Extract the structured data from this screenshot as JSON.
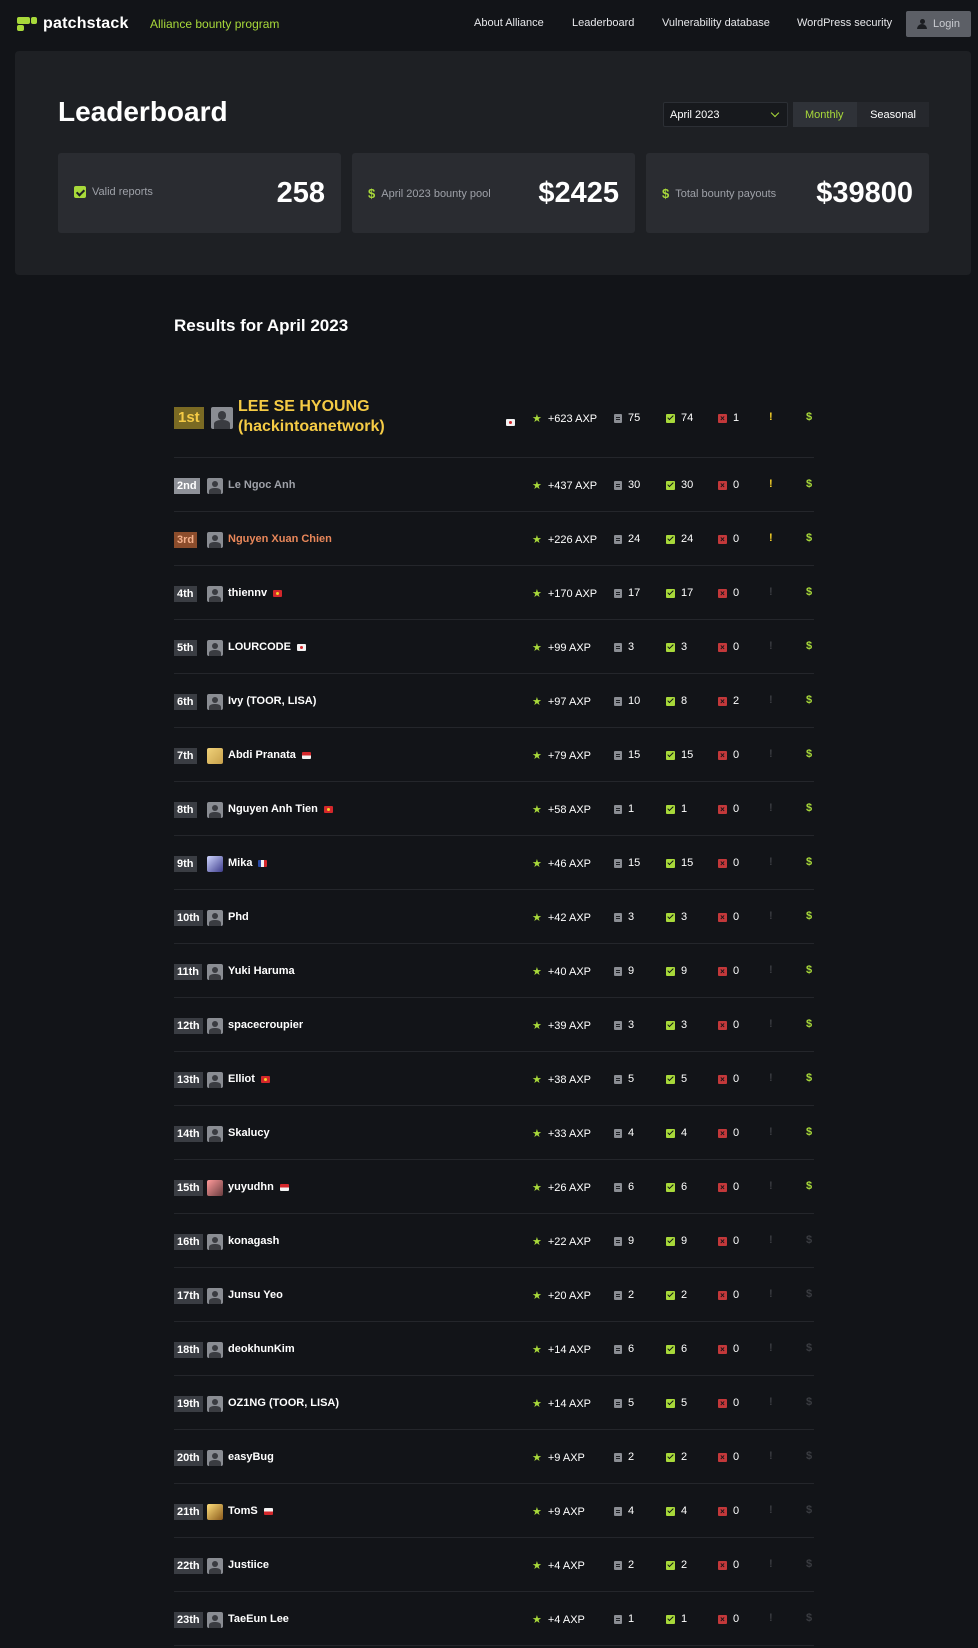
{
  "nav": {
    "logo_text": "patchstack",
    "program_label": "Alliance bounty program",
    "links": [
      "About Alliance",
      "Leaderboard",
      "Vulnerability database",
      "WordPress security"
    ],
    "login_label": "Login"
  },
  "hero": {
    "title": "Leaderboard",
    "selected_month": "April 2023",
    "toggle": {
      "monthly": "Monthly",
      "seasonal": "Seasonal",
      "active": "Monthly"
    },
    "stats": [
      {
        "label": "Valid reports",
        "value": "258",
        "icon": "check-icon"
      },
      {
        "label": "April 2023 bounty pool",
        "value": "$2425",
        "icon": "dollar-icon"
      },
      {
        "label": "Total bounty payouts",
        "value": "$39800",
        "icon": "dollar-icon"
      }
    ]
  },
  "results": {
    "title": "Results for April 2023",
    "rows": [
      {
        "rank": "1st",
        "name": "LEE SE HYOUNG (hackintoanetwork)",
        "flag": "kr",
        "axp": "+623 AXP",
        "submitted": "75",
        "valid": "74",
        "invalid": "1",
        "trophy": true,
        "bounty": true,
        "avatar": "default"
      },
      {
        "rank": "2nd",
        "name": "Le Ngoc Anh",
        "flag": "",
        "axp": "+437 AXP",
        "submitted": "30",
        "valid": "30",
        "invalid": "0",
        "trophy": true,
        "bounty": true,
        "avatar": "default"
      },
      {
        "rank": "3rd",
        "name": "Nguyen Xuan Chien",
        "flag": "",
        "axp": "+226 AXP",
        "submitted": "24",
        "valid": "24",
        "invalid": "0",
        "trophy": true,
        "bounty": true,
        "avatar": "default"
      },
      {
        "rank": "4th",
        "name": "thiennv",
        "flag": "vn",
        "axp": "+170 AXP",
        "submitted": "17",
        "valid": "17",
        "invalid": "0",
        "trophy": false,
        "bounty": true,
        "avatar": "default"
      },
      {
        "rank": "5th",
        "name": "LOURCODE",
        "flag": "kr",
        "axp": "+99 AXP",
        "submitted": "3",
        "valid": "3",
        "invalid": "0",
        "trophy": false,
        "bounty": true,
        "avatar": "default"
      },
      {
        "rank": "6th",
        "name": "Ivy (TOOR, LISA)",
        "flag": "",
        "axp": "+97 AXP",
        "submitted": "10",
        "valid": "8",
        "invalid": "2",
        "trophy": false,
        "bounty": true,
        "avatar": "default"
      },
      {
        "rank": "7th",
        "name": "Abdi Pranata",
        "flag": "id",
        "axp": "+79 AXP",
        "submitted": "15",
        "valid": "15",
        "invalid": "0",
        "trophy": false,
        "bounty": true,
        "avatar": "photo1"
      },
      {
        "rank": "8th",
        "name": "Nguyen Anh Tien",
        "flag": "vn",
        "axp": "+58 AXP",
        "submitted": "1",
        "valid": "1",
        "invalid": "0",
        "trophy": false,
        "bounty": true,
        "avatar": "default"
      },
      {
        "rank": "9th",
        "name": "Mika",
        "flag": "fr",
        "axp": "+46 AXP",
        "submitted": "15",
        "valid": "15",
        "invalid": "0",
        "trophy": false,
        "bounty": true,
        "avatar": "photo2"
      },
      {
        "rank": "10th",
        "name": "Phd",
        "flag": "",
        "axp": "+42 AXP",
        "submitted": "3",
        "valid": "3",
        "invalid": "0",
        "trophy": false,
        "bounty": true,
        "avatar": "default"
      },
      {
        "rank": "11th",
        "name": "Yuki Haruma",
        "flag": "",
        "axp": "+40 AXP",
        "submitted": "9",
        "valid": "9",
        "invalid": "0",
        "trophy": false,
        "bounty": true,
        "avatar": "default"
      },
      {
        "rank": "12th",
        "name": "spacecroupier",
        "flag": "",
        "axp": "+39 AXP",
        "submitted": "3",
        "valid": "3",
        "invalid": "0",
        "trophy": false,
        "bounty": true,
        "avatar": "default"
      },
      {
        "rank": "13th",
        "name": "Elliot",
        "flag": "vn",
        "axp": "+38 AXP",
        "submitted": "5",
        "valid": "5",
        "invalid": "0",
        "trophy": false,
        "bounty": true,
        "avatar": "default"
      },
      {
        "rank": "14th",
        "name": "Skalucy",
        "flag": "",
        "axp": "+33 AXP",
        "submitted": "4",
        "valid": "4",
        "invalid": "0",
        "trophy": false,
        "bounty": true,
        "avatar": "default"
      },
      {
        "rank": "15th",
        "name": "yuyudhn",
        "flag": "id",
        "axp": "+26 AXP",
        "submitted": "6",
        "valid": "6",
        "invalid": "0",
        "trophy": false,
        "bounty": true,
        "avatar": "photo3"
      },
      {
        "rank": "16th",
        "name": "konagash",
        "flag": "",
        "axp": "+22 AXP",
        "submitted": "9",
        "valid": "9",
        "invalid": "0",
        "trophy": false,
        "bounty": false,
        "avatar": "default"
      },
      {
        "rank": "17th",
        "name": "Junsu Yeo",
        "flag": "",
        "axp": "+20 AXP",
        "submitted": "2",
        "valid": "2",
        "invalid": "0",
        "trophy": false,
        "bounty": false,
        "avatar": "default"
      },
      {
        "rank": "18th",
        "name": "deokhunKim",
        "flag": "",
        "axp": "+14 AXP",
        "submitted": "6",
        "valid": "6",
        "invalid": "0",
        "trophy": false,
        "bounty": false,
        "avatar": "default"
      },
      {
        "rank": "19th",
        "name": "OZ1NG (TOOR, LISA)",
        "flag": "",
        "axp": "+14 AXP",
        "submitted": "5",
        "valid": "5",
        "invalid": "0",
        "trophy": false,
        "bounty": false,
        "avatar": "default"
      },
      {
        "rank": "20th",
        "name": "easyBug",
        "flag": "",
        "axp": "+9 AXP",
        "submitted": "2",
        "valid": "2",
        "invalid": "0",
        "trophy": false,
        "bounty": false,
        "avatar": "default"
      },
      {
        "rank": "21th",
        "name": "TomS",
        "flag": "pl",
        "axp": "+9 AXP",
        "submitted": "4",
        "valid": "4",
        "invalid": "0",
        "trophy": false,
        "bounty": false,
        "avatar": "photo4"
      },
      {
        "rank": "22th",
        "name": "Justiice",
        "flag": "",
        "axp": "+4 AXP",
        "submitted": "2",
        "valid": "2",
        "invalid": "0",
        "trophy": false,
        "bounty": false,
        "avatar": "default"
      },
      {
        "rank": "23th",
        "name": "TaeEun Lee",
        "flag": "",
        "axp": "+4 AXP",
        "submitted": "1",
        "valid": "1",
        "invalid": "0",
        "trophy": false,
        "bounty": false,
        "avatar": "default"
      }
    ]
  },
  "icons": {
    "axp": "star-icon",
    "submitted": "report-icon",
    "valid": "check-icon",
    "invalid": "x-icon",
    "trophy": "trophy-icon",
    "bounty": "dollar-icon"
  },
  "colors": {
    "accent": "#a8d93a",
    "gold": "#f5cb45",
    "bronze": "#e9875a",
    "invalid": "#c3383a",
    "background": "#121418"
  }
}
